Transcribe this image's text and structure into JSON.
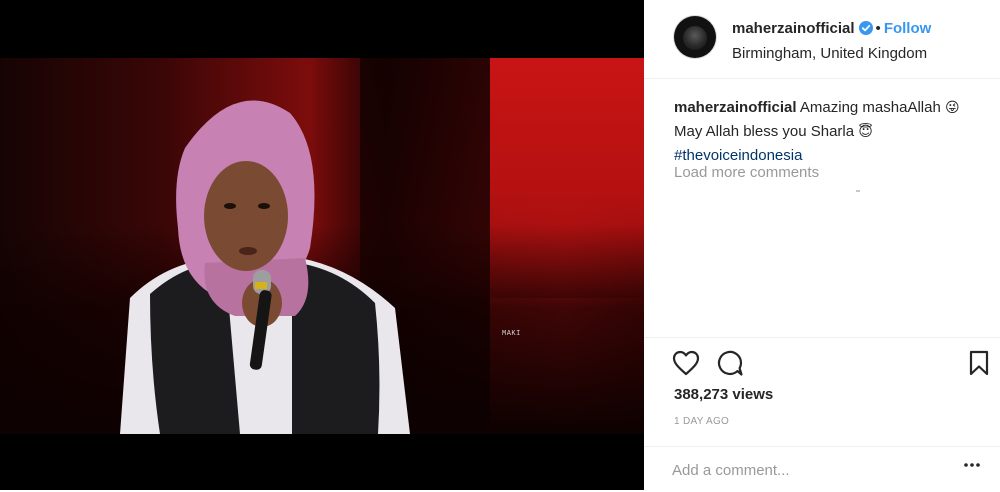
{
  "header": {
    "username": "maherzainofficial",
    "separator": "•",
    "follow_label": "Follow",
    "location": "Birmingham, United Kingdom"
  },
  "video": {
    "corner_tag": "MAKI"
  },
  "caption": {
    "username": "maherzainofficial",
    "text_line1": "Amazing mashaAllah",
    "emoji1": "😜",
    "text_line2": "May Allah bless you Sharla",
    "emoji2": "😇",
    "hashtag": "#thevoiceindonesia"
  },
  "load_more_label": "Load more comments",
  "stats": {
    "views": "388,273 views",
    "time_ago": "1 DAY AGO"
  },
  "comment_box": {
    "placeholder": "Add a comment..."
  },
  "icons": {
    "like": "heart-icon",
    "comment": "comment-bubble-icon",
    "save": "bookmark-icon",
    "more": "more-options-icon",
    "verified": "verified-badge-icon"
  },
  "colors": {
    "accent": "#3897f0",
    "hashtag": "#003569",
    "muted": "#999999",
    "text": "#262626"
  }
}
